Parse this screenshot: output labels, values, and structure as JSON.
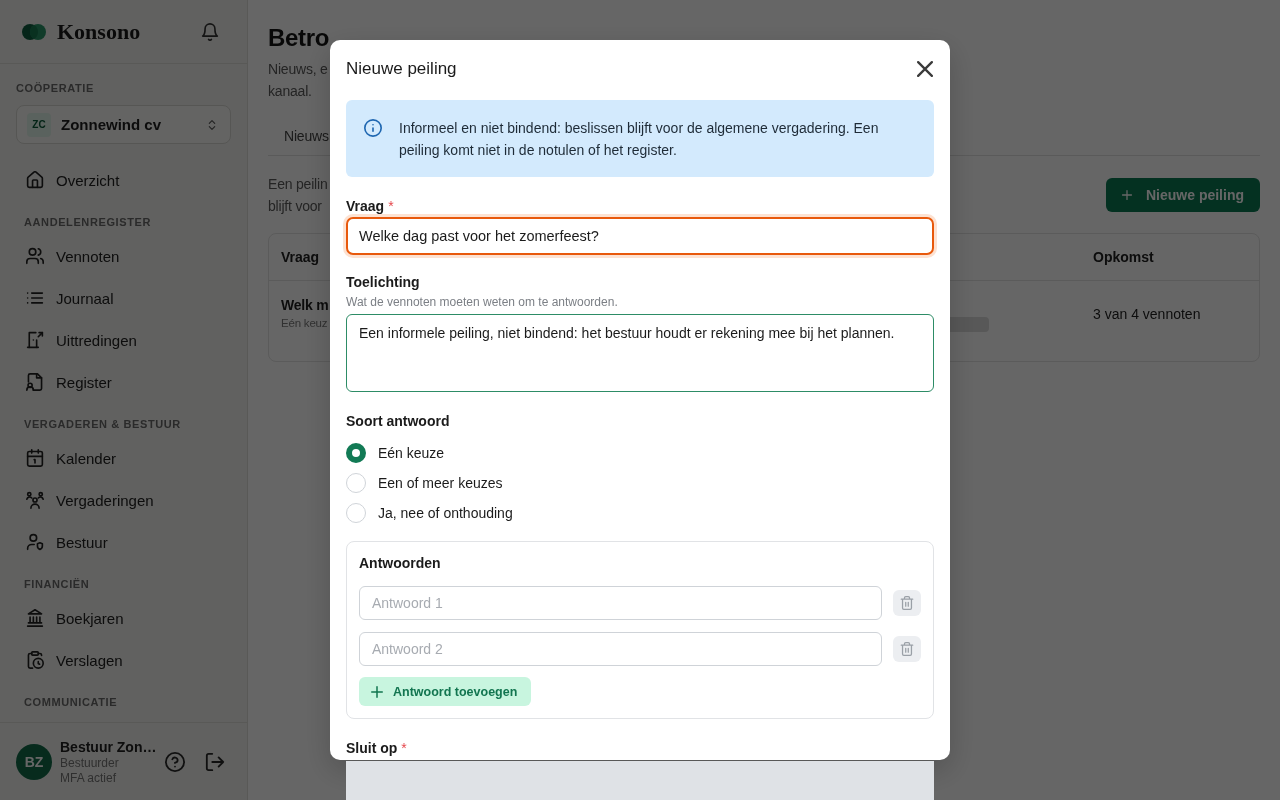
{
  "sidebar": {
    "brand": "Konsono",
    "organization": {
      "label": "COÖPERATIE",
      "initials": "ZC",
      "name": "Zonnewind cv"
    },
    "nav_sections": [
      {
        "items": [
          {
            "label": "Overzicht",
            "selected": false
          }
        ]
      },
      {
        "heading": "AANDELENREGISTER",
        "items": [
          {
            "label": "Vennoten",
            "selected": false
          },
          {
            "label": "Journaal",
            "selected": false
          },
          {
            "label": "Uittredingen",
            "selected": false
          },
          {
            "label": "Register",
            "selected": false
          }
        ]
      },
      {
        "heading": "VERGADEREN & BESTUUR",
        "items": [
          {
            "label": "Kalender",
            "selected": false
          },
          {
            "label": "Vergaderingen",
            "selected": false
          },
          {
            "label": "Bestuur",
            "selected": false
          }
        ]
      },
      {
        "heading": "FINANCIËN",
        "items": [
          {
            "label": "Boekjaren",
            "selected": false
          },
          {
            "label": "Verslagen",
            "selected": false
          }
        ]
      },
      {
        "heading": "COMMUNICATIE"
      }
    ],
    "user": {
      "initials": "BZ",
      "name": "Bestuur Zon…",
      "role": "Bestuurder",
      "status": "MFA actief"
    }
  },
  "page": {
    "title": "Betro",
    "subtitle_lines": [
      "Nieuws, e",
      "kanaal."
    ],
    "tabs": [
      {
        "label": "Nieuws",
        "selected": false
      }
    ],
    "intro_lines": [
      "Een peilin",
      "blijft voor"
    ],
    "new_poll_button": "Nieuwe peiling",
    "table": {
      "columns": [
        "Vraag",
        "Opkomst"
      ],
      "rows": [
        {
          "question": "Welk m",
          "answer_type": "Eén keuz",
          "turnout": "3 van 4 vennoten"
        }
      ]
    }
  },
  "dialog": {
    "title": "Nieuwe peiling",
    "notice": "Informeel en niet bindend: beslissen blijft voor de algemene vergadering. Een peiling komt niet in de notulen of het register.",
    "fields": [
      {
        "kind": "text",
        "label": "Vraag",
        "required_mark": "*",
        "value": "Welke dag past voor het zomerfeest?",
        "focused": true
      },
      {
        "kind": "textarea",
        "label": "Toelichting",
        "hint": "Wat de vennoten moeten weten om te antwoorden.",
        "value": "Een informele peiling, niet bindend: het bestuur houdt er rekening mee bij het plannen.",
        "focused": false
      }
    ],
    "answer_type": {
      "label": "Soort antwoord",
      "options": [
        {
          "label": "Eén keuze",
          "selected": true
        },
        {
          "label": "Een of meer keuzes",
          "selected": false
        },
        {
          "label": "Ja, nee of onthouding",
          "selected": false
        }
      ]
    },
    "answers": {
      "title": "Antwoorden",
      "items": [
        {
          "placeholder": "Antwoord 1"
        },
        {
          "placeholder": "Antwoord 2"
        }
      ],
      "add_button": "Antwoord toevoegen"
    },
    "closing": {
      "label": "Sluit op",
      "required_mark": "*"
    }
  }
}
